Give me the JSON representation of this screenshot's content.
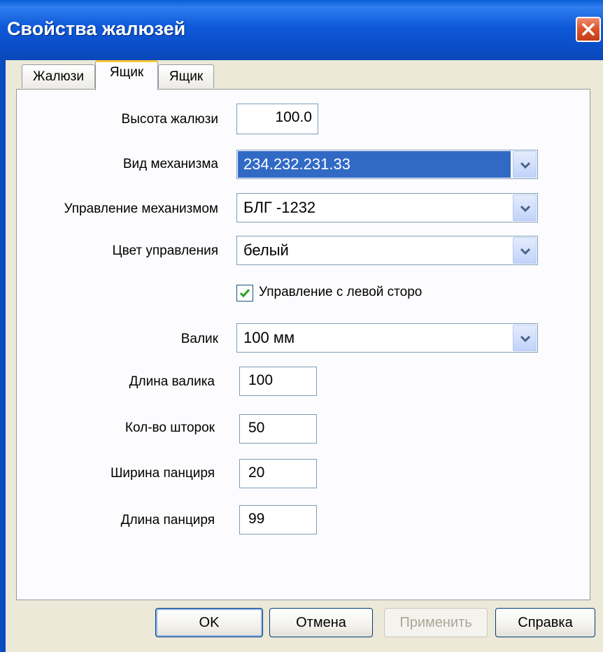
{
  "window": {
    "title": "Свойства жалюзей"
  },
  "tabs": [
    {
      "label": "Жалюзи",
      "active": false
    },
    {
      "label": "Ящик",
      "active": true
    },
    {
      "label": "Ящик",
      "active": false
    }
  ],
  "form": {
    "blind_height": {
      "label": "Высота жалюзи",
      "value": "100.0"
    },
    "mechanism_type": {
      "label": "Вид механизма",
      "value": "234.232.231.33"
    },
    "mechanism_control": {
      "label": "Управление механизмом",
      "value": "БЛГ -1232"
    },
    "control_color": {
      "label": "Цвет управления",
      "value": "белый"
    },
    "left_control": {
      "label": "Управление с левой сторо",
      "checked": true
    },
    "roller": {
      "label": "Валик",
      "value": "100 мм"
    },
    "roller_length": {
      "label": "Длина валика",
      "value": "100"
    },
    "slat_count": {
      "label": "Кол-во шторок",
      "value": "50"
    },
    "armor_width": {
      "label": "Ширина панциря",
      "value": "20"
    },
    "armor_length": {
      "label": "Длина панциря",
      "value": "99"
    }
  },
  "buttons": {
    "ok": "OK",
    "cancel": "Отмена",
    "apply": "Применить",
    "help": "Справка"
  },
  "colors": {
    "titlebar": "#0a4ec7",
    "selection": "#316ac5",
    "active_tab_accent": "#ffc73c",
    "close_button": "#d9532c"
  },
  "icons": [
    "close-icon",
    "chevron-down-icon",
    "checkmark-icon"
  ]
}
